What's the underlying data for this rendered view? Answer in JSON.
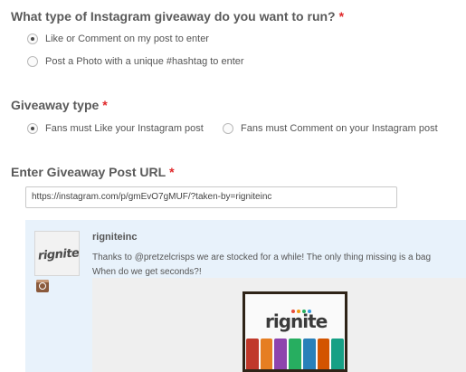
{
  "giveaway_question": {
    "title": "What type of Instagram giveaway do you want to run?",
    "required_mark": "*",
    "options": [
      {
        "label": "Like or Comment on my post to enter",
        "checked": true
      },
      {
        "label": "Post a Photo with a unique #hashtag to enter",
        "checked": false
      }
    ]
  },
  "giveaway_type": {
    "title": "Giveaway type",
    "required_mark": "*",
    "options": [
      {
        "label": "Fans must Like your Instagram post",
        "checked": true
      },
      {
        "label": "Fans must Comment on your Instagram post",
        "checked": false
      }
    ]
  },
  "post_url": {
    "title": "Enter Giveaway Post URL",
    "required_mark": "*",
    "value": "https://instagram.com/p/gmEvO7gMUF/?taken-by=rigniteinc"
  },
  "embed": {
    "username": "rigniteinc",
    "avatar_text": "rignite",
    "caption_line1": "Thanks to @pretzelcrisps we are stocked for a while! The only thing missing is a bag",
    "caption_line2": "When do we get seconds?!",
    "photo_text": "rignite",
    "icon": "instagram-icon",
    "colors": {
      "background": "#e8f2fb",
      "photo_frame": "#2f2418",
      "accent_bags": [
        "#c0392b",
        "#e67e22",
        "#8e44ad",
        "#27ae60",
        "#2980b9",
        "#d35400",
        "#16a085"
      ],
      "logo_dots": [
        "#e74c3c",
        "#f39c12",
        "#27ae60",
        "#3498db"
      ]
    }
  },
  "colors": {
    "required": "#e0282a",
    "heading": "#5a5a5a"
  }
}
